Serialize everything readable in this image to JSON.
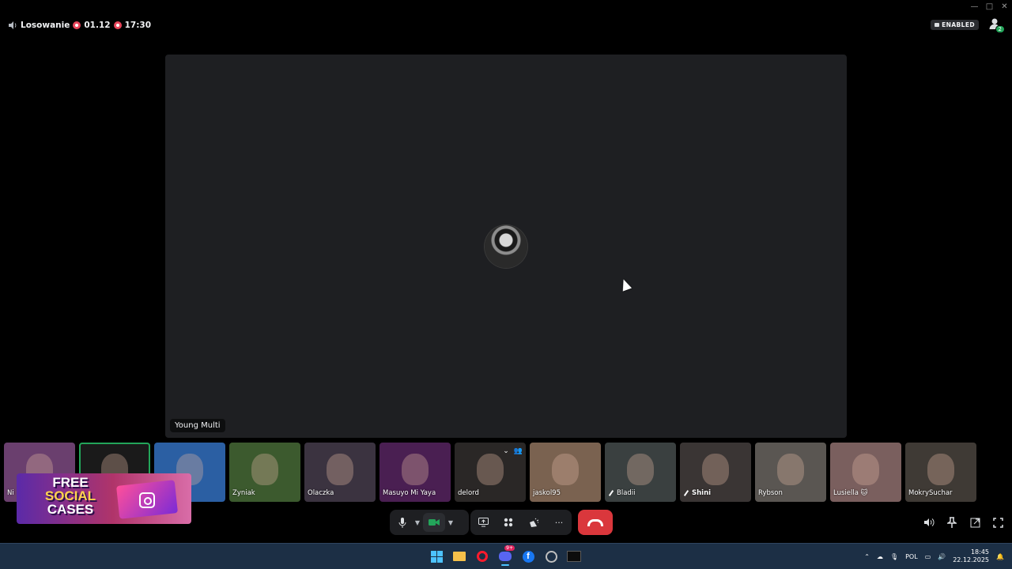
{
  "window": {
    "controls": [
      "—",
      "□",
      "✕"
    ]
  },
  "channel": {
    "name": "Losowanie",
    "date": "01.12",
    "time": "17:30",
    "badge": "ENABLED",
    "participants_badge": "2"
  },
  "stage": {
    "speaker_name": "Young Multi"
  },
  "participants": [
    {
      "name": "Ni",
      "muted": false,
      "bold": false,
      "color": "#6a3f6e"
    },
    {
      "name": "",
      "muted": false,
      "bold": false,
      "color": "#1a1a1a",
      "selected": true
    },
    {
      "name": "",
      "muted": false,
      "bold": false,
      "color": "#2b5fa3"
    },
    {
      "name": "Zyniak",
      "muted": false,
      "bold": false,
      "color": "#3c5a2e"
    },
    {
      "name": "Olaczka",
      "muted": false,
      "bold": false,
      "color": "#3b3340"
    },
    {
      "name": "Masuyo Mi Yaya",
      "muted": false,
      "bold": false,
      "color": "#4a1f52"
    },
    {
      "name": "delord",
      "muted": false,
      "bold": false,
      "color": "#2a2726"
    },
    {
      "name": "jaskol95",
      "muted": false,
      "bold": false,
      "color": "#7a6250"
    },
    {
      "name": "Bladii",
      "muted": true,
      "bold": false,
      "color": "#3a4040"
    },
    {
      "name": "Shini",
      "muted": true,
      "bold": true,
      "color": "#3a3534"
    },
    {
      "name": "Rybson",
      "muted": false,
      "bold": false,
      "color": "#5a5652"
    },
    {
      "name": "Lusiella 🐱",
      "muted": false,
      "bold": false,
      "color": "#7a5f5e"
    },
    {
      "name": "MokrySuchar",
      "muted": false,
      "bold": false,
      "color": "#3f3a35"
    }
  ],
  "ad": {
    "line1": "FREE",
    "line2": "SOCIAL",
    "line3": "CASES"
  },
  "controls": {
    "mic": "mic-icon",
    "camera": "camera-icon",
    "share": "screen-share-icon",
    "activities": "activities-icon",
    "soundboard": "soundboard-icon",
    "more": "···",
    "hangup": "hangup-icon"
  },
  "taskbar": {
    "lang": "POL",
    "time": "18:45",
    "date": "22.12.2025",
    "discord_badge": "9+"
  },
  "colors": {
    "accent_green": "#23a55a",
    "hangup_red": "#da373c",
    "stage_bg": "#1e1f22"
  }
}
